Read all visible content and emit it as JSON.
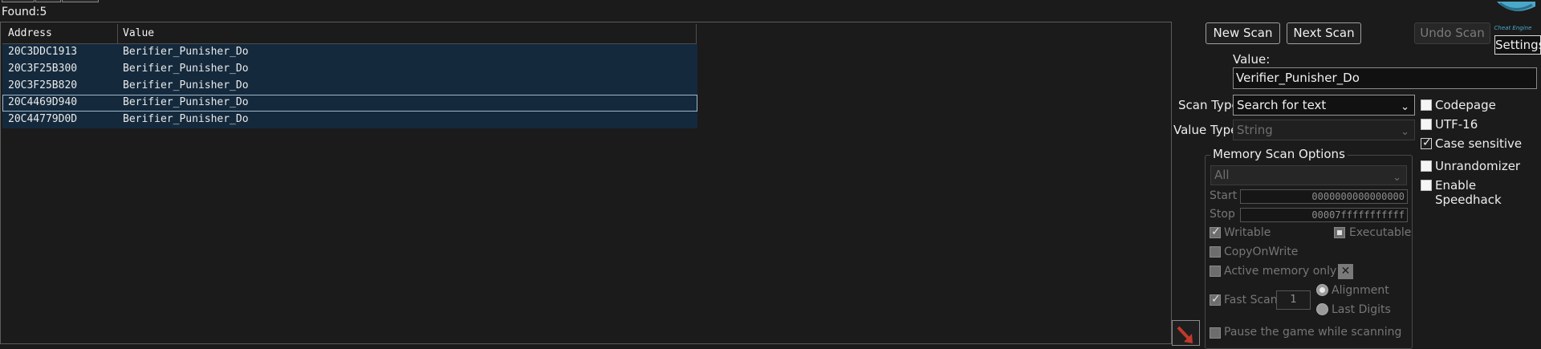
{
  "found": {
    "label": "Found:",
    "count": "5"
  },
  "results": {
    "columns": [
      "Address",
      "Value"
    ],
    "rows": [
      {
        "address": "20C3DDC1913",
        "value": "Berifier_Punisher_Do"
      },
      {
        "address": "20C3F25B300",
        "value": "Berifier_Punisher_Do"
      },
      {
        "address": "20C3F25B820",
        "value": "Berifier_Punisher_Do"
      },
      {
        "address": "20C4469D940",
        "value": "Berifier_Punisher_Do"
      },
      {
        "address": "20C44779D0D",
        "value": "Berifier_Punisher_Do"
      }
    ]
  },
  "toolbar": {
    "new_scan": "New Scan",
    "next_scan": "Next Scan",
    "undo_scan": "Undo Scan",
    "settings": "Settings"
  },
  "scan": {
    "value_label": "Value:",
    "value": "Verifier_Punisher_Do",
    "scan_type_label": "Scan Type",
    "scan_type": "Search for text",
    "value_type_label": "Value Type",
    "value_type": "String"
  },
  "options": {
    "codepage": {
      "label": "Codepage",
      "checked": false
    },
    "utf16": {
      "label": "UTF-16",
      "checked": false
    },
    "case_sensitive": {
      "label": "Case sensitive",
      "checked": true
    },
    "unrandomizer": {
      "label": "Unrandomizer",
      "checked": false
    },
    "speedhack": {
      "label": "Enable Speedhack",
      "checked": false
    }
  },
  "memory": {
    "title": "Memory Scan Options",
    "region": "All",
    "start_label": "Start",
    "start": "0000000000000000",
    "stop_label": "Stop",
    "stop": "00007fffffffffff",
    "writable": "Writable",
    "executable": "Executable",
    "copy_on_write": "CopyOnWrite",
    "active_only": "Active memory only",
    "fast_scan": "Fast Scan",
    "fast_scan_value": "1",
    "alignment": "Alignment",
    "last_digits": "Last Digits",
    "pause": "Pause the game while scanning"
  },
  "colors": {
    "row_bg": "#14293c",
    "accent_arrow": "#c0392b"
  }
}
